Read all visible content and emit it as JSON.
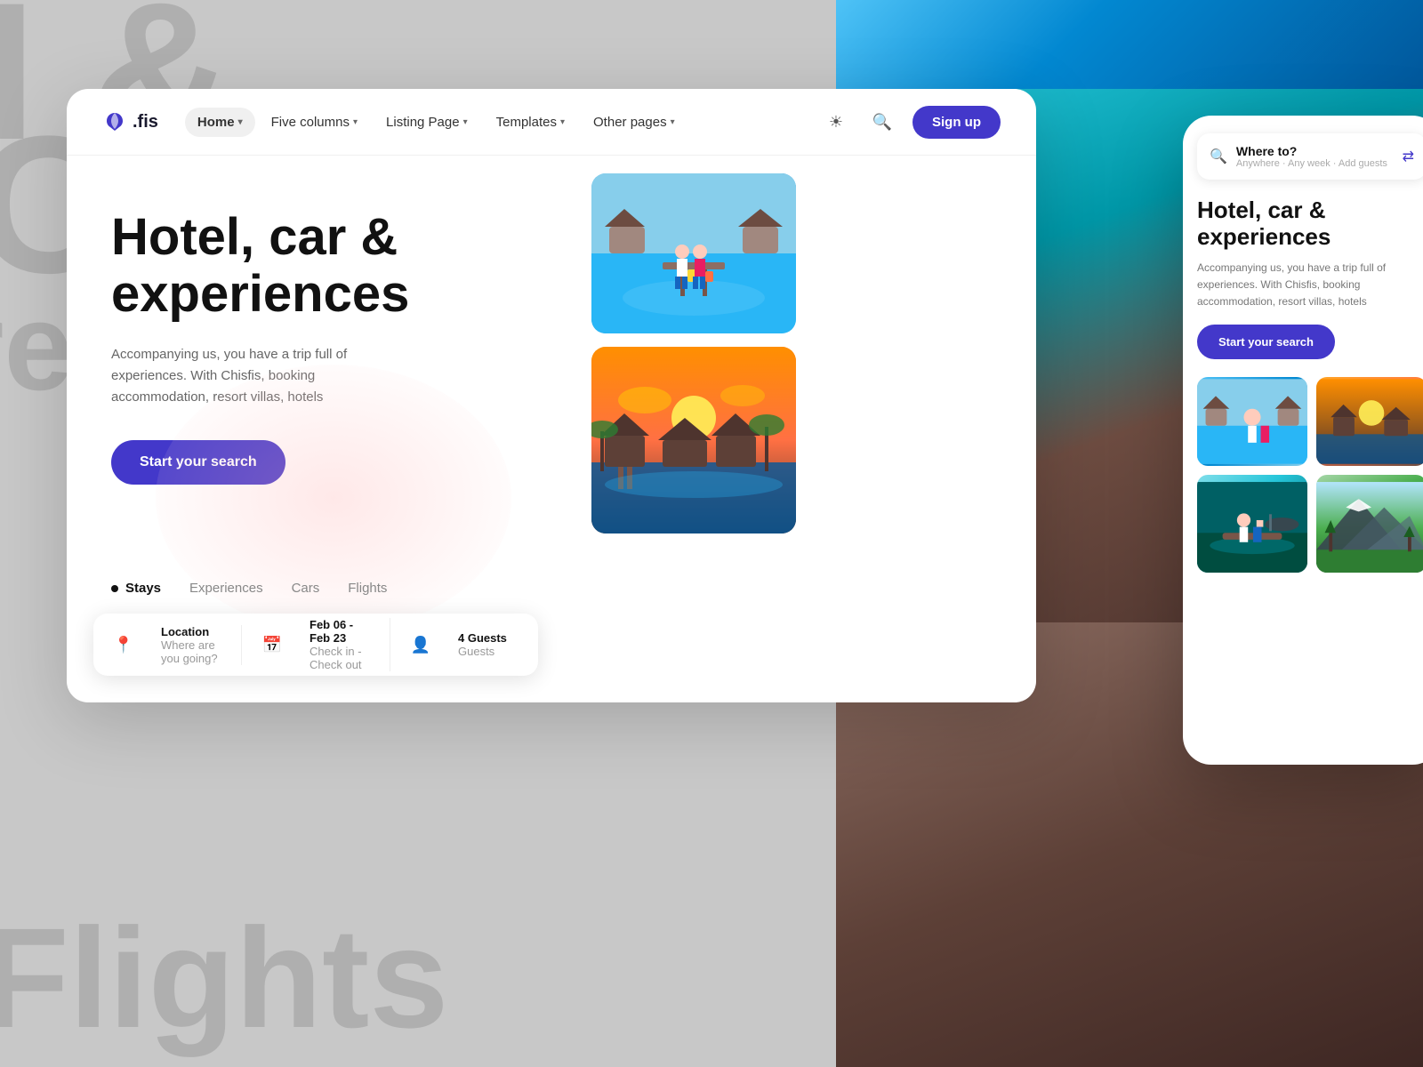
{
  "background": {
    "text1": "I &",
    "text2": "C",
    "text3": "reso",
    "text4": "Flights"
  },
  "navbar": {
    "logo_text": ".fis",
    "items": [
      {
        "label": "Home",
        "active": true,
        "has_chevron": true
      },
      {
        "label": "Five columns",
        "active": false,
        "has_chevron": true
      },
      {
        "label": "Listing Page",
        "active": false,
        "has_chevron": true
      },
      {
        "label": "Templates",
        "active": false,
        "has_chevron": true
      },
      {
        "label": "Other pages",
        "active": false,
        "has_chevron": true
      }
    ],
    "signup_label": "Sign up"
  },
  "hero": {
    "title": "Hotel, car & experiences",
    "description": "Accompanying us, you have a trip full of experiences. With Chisfis, booking accommodation, resort villas, hotels",
    "search_button": "Start your search"
  },
  "tabs": [
    {
      "label": "Stays",
      "active": true
    },
    {
      "label": "Experiences",
      "active": false
    },
    {
      "label": "Cars",
      "active": false
    },
    {
      "label": "Flights",
      "active": false
    }
  ],
  "search_bar": {
    "location_label": "Location",
    "location_placeholder": "Where are you going?",
    "date_label": "Feb 06 - Feb 23",
    "date_sub": "Check in - Check out",
    "guests_label": "4 Guests",
    "guests_sub": "Guests"
  },
  "mobile": {
    "search_main": "Where to?",
    "search_sub": "Anywhere · Any week · Add guests",
    "title": "Hotel, car & experiences",
    "description": "Accompanying us, you have a trip full of experiences. With Chisfis, booking accommodation, resort villas, hotels",
    "search_button": "Start your search"
  }
}
